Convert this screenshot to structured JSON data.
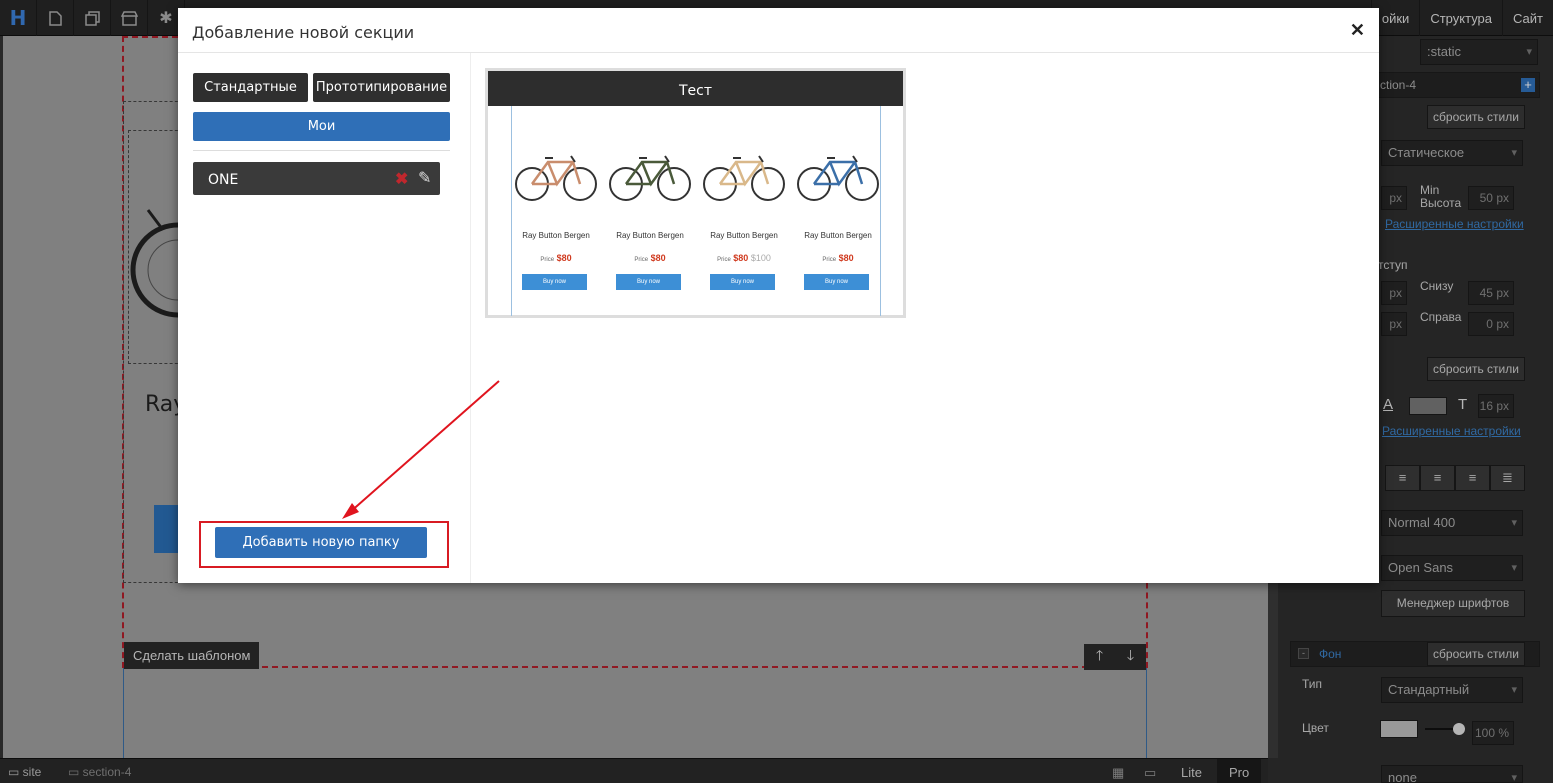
{
  "toolbar": {
    "logo": "H",
    "links": [
      "ойки",
      "Структура",
      "Сайт"
    ]
  },
  "canvas": {
    "partial_heading": "Ray",
    "make_template": "Сделать шаблоном"
  },
  "right_panel": {
    "state_select": ":static",
    "section_id": "ction-4",
    "reset_styles": "сбросить стили",
    "position_select": "Статическое",
    "min_height_label": "Min\nВысота",
    "min_height_value": "50",
    "unit_px": "px",
    "advanced_link": "Расширенные настройки",
    "indent_label": "тступ",
    "bottom_label": "Снизу",
    "bottom_value": "45",
    "right_label": "Справа",
    "right_value": "0",
    "font_size": "16 px",
    "weight_select": "Normal 400",
    "font_select": "Open Sans",
    "font_manager": "Менеджер шрифтов",
    "bg_label": "Фон",
    "type_label": "Тип",
    "type_select": "Стандартный",
    "color_label": "Цвет",
    "opacity": "100 %",
    "bottom_select": "none",
    "align_icons": [
      "align-left-icon",
      "align-center-icon",
      "align-right-icon",
      "align-justify-icon"
    ],
    "colors": {
      "link": "#3b80c6"
    }
  },
  "statusbar": {
    "crumb_site": "site",
    "crumb_section": "section-4",
    "mode_lite": "Lite",
    "mode_pro": "Pro"
  },
  "modal": {
    "title": "Добавление новой секции",
    "tabs": {
      "standard": "Стандартные",
      "prototyping": "Прототипирование",
      "mine": "Мои"
    },
    "folders": [
      {
        "label": "ONE"
      }
    ],
    "add_folder": "Добавить новую папку",
    "template": {
      "title": "Тест",
      "products": [
        {
          "name": "Ray Button Bergen",
          "price_label": "Price",
          "price": "$80",
          "old_price": "",
          "buy": "Buy now",
          "color": "#c98d6d"
        },
        {
          "name": "Ray Button Bergen",
          "price_label": "Price",
          "price": "$80",
          "old_price": "",
          "buy": "Buy now",
          "color": "#4a5a3a"
        },
        {
          "name": "Ray Button Bergen",
          "price_label": "Price",
          "price": "$80",
          "old_price": "$100",
          "buy": "Buy now",
          "color": "#d9b88a"
        },
        {
          "name": "Ray Button Bergen",
          "price_label": "Price",
          "price": "$80",
          "old_price": "",
          "buy": "Buy now",
          "color": "#3b6fa8"
        }
      ]
    },
    "colors": {
      "primary": "#2f6fb7",
      "dark": "#2f2f2f",
      "annotation": "#d81b23"
    }
  }
}
